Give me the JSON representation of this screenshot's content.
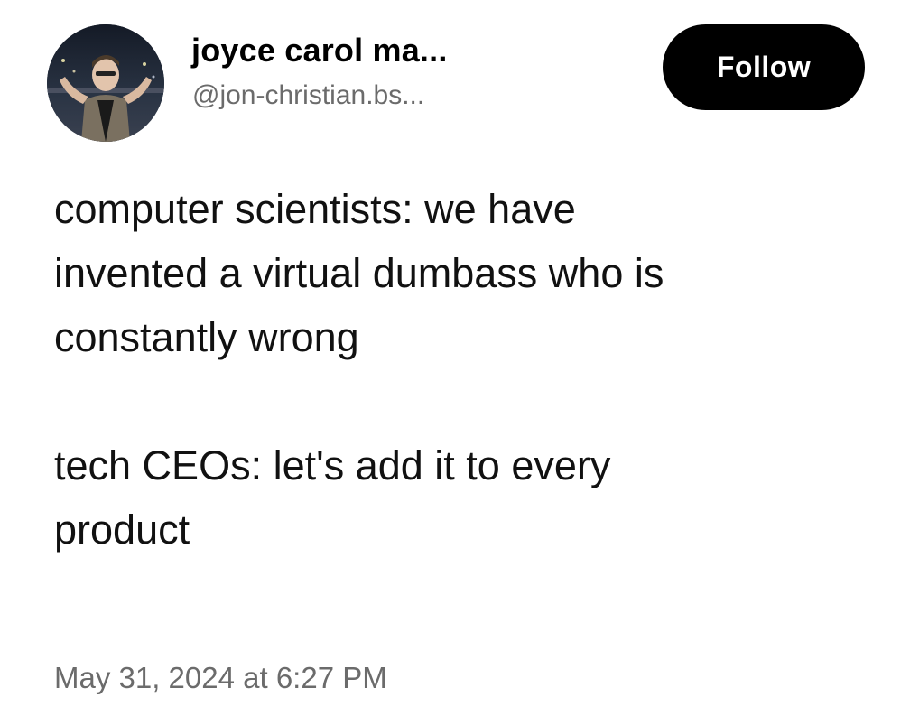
{
  "author": {
    "display_name": "joyce carol ma...",
    "handle": "@jon-christian.bs...",
    "avatar_icon": "profile-photo"
  },
  "follow_button": {
    "label": "Follow"
  },
  "post": {
    "paragraphs": [
      "computer scientists: we have\ninvented a virtual dumbass who is\nconstantly wrong",
      "tech CEOs: let's add it to every\nproduct"
    ],
    "timestamp": "May 31, 2024 at 6:27 PM"
  },
  "colors": {
    "text": "#111111",
    "muted": "#6b6b6b",
    "button_bg": "#000000",
    "button_text": "#ffffff",
    "background": "#ffffff"
  }
}
